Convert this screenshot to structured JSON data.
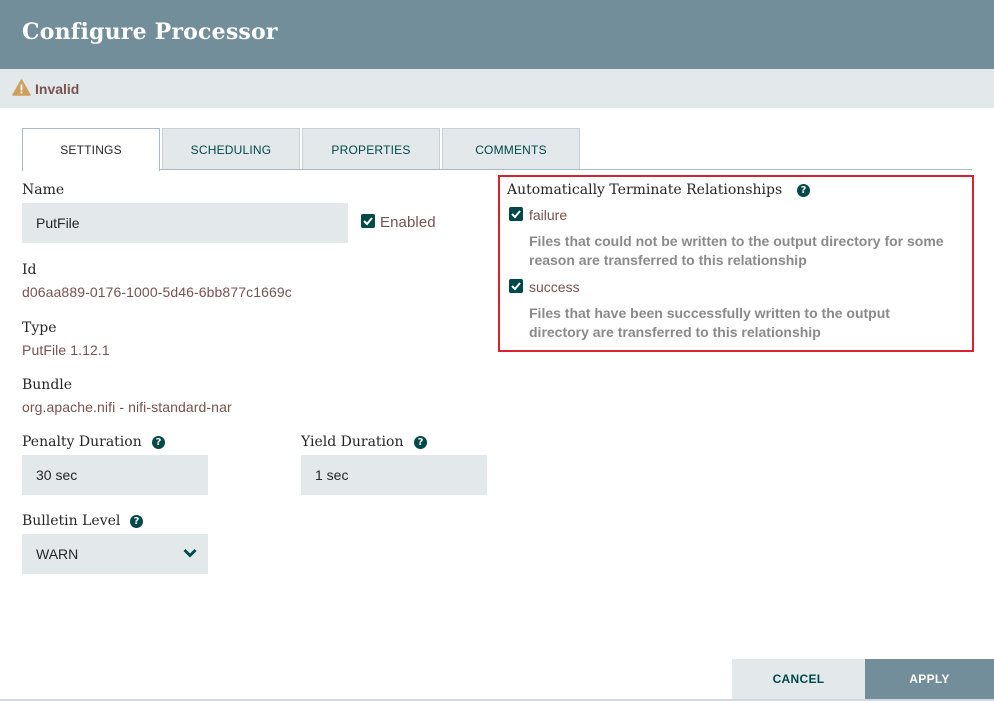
{
  "dialog": {
    "title": "Configure Processor"
  },
  "status": {
    "text": "Invalid",
    "icon": "warning-icon"
  },
  "tabs": [
    {
      "label": "SETTINGS"
    },
    {
      "label": "SCHEDULING"
    },
    {
      "label": "PROPERTIES"
    },
    {
      "label": "COMMENTS"
    }
  ],
  "settings": {
    "name_label": "Name",
    "name_value": "PutFile",
    "enabled_label": "Enabled",
    "id_label": "Id",
    "id_value": "d06aa889-0176-1000-5d46-6bb877c1669c",
    "type_label": "Type",
    "type_value": "PutFile 1.12.1",
    "bundle_label": "Bundle",
    "bundle_value": "org.apache.nifi - nifi-standard-nar",
    "penalty_label": "Penalty Duration",
    "penalty_value": "30 sec",
    "yield_label": "Yield Duration",
    "yield_value": "1 sec",
    "bulletin_label": "Bulletin Level",
    "bulletin_value": "WARN"
  },
  "relationships": {
    "title": "Automatically Terminate Relationships",
    "items": [
      {
        "name": "failure",
        "checked": true,
        "description": "Files that could not be written to the output directory for some reason are transferred to this relationship"
      },
      {
        "name": "success",
        "checked": true,
        "description": "Files that have been successfully written to the output directory are transferred to this relationship"
      }
    ]
  },
  "buttons": {
    "cancel": "CANCEL",
    "apply": "APPLY"
  },
  "colors": {
    "header": "#728e9b",
    "accent": "#004849",
    "value": "#775351",
    "highlight_border": "#d6232f"
  }
}
